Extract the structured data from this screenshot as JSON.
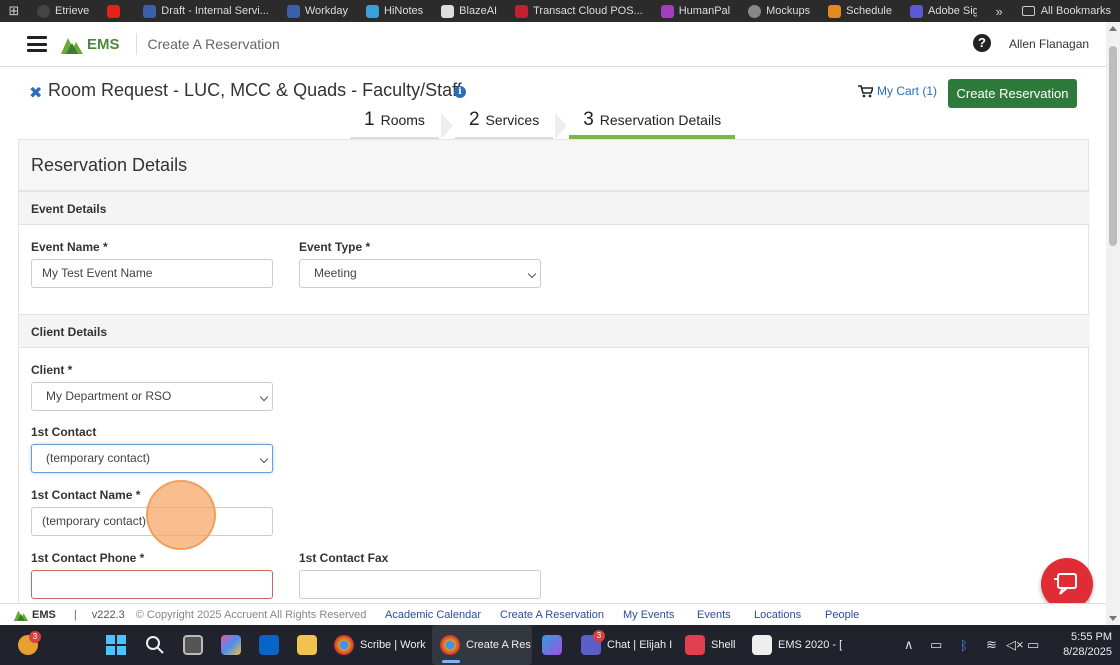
{
  "bookmarks": {
    "items": [
      "Etrieve",
      "Draft - Internal Servi...",
      "Workday",
      "HiNotes",
      "BlazeAI",
      "Transact Cloud POS...",
      "HumanPal",
      "Mockups",
      "Schedule",
      "Adobe Sign"
    ],
    "more": "»",
    "all_bookmarks": "All Bookmarks"
  },
  "header": {
    "brand": "EMS",
    "title": "Create A Reservation",
    "help": "?",
    "user": "Allen Flanagan"
  },
  "page": {
    "close": "✖",
    "title": "Room Request - LUC, MCC & Quads - Faculty/Staff",
    "info": "i",
    "cart_label": "My Cart (1)",
    "create_button": "Create Reservation"
  },
  "wizard": {
    "steps": [
      {
        "num": "1",
        "label": "Rooms"
      },
      {
        "num": "2",
        "label": "Services"
      },
      {
        "num": "3",
        "label": "Reservation Details"
      }
    ],
    "active_step": 3
  },
  "form": {
    "heading": "Reservation Details",
    "event_section": "Event Details",
    "event_name_label": "Event Name *",
    "event_name_value": "My Test Event Name",
    "event_type_label": "Event Type *",
    "event_type_value": "Meeting",
    "client_section": "Client Details",
    "client_label": "Client *",
    "client_value": "My Department or RSO",
    "contact_label": "1st Contact",
    "contact_value": "(temporary contact)",
    "contact_name_label": "1st Contact Name *",
    "contact_name_value": "(temporary contact)",
    "contact_phone_label": "1st Contact Phone *",
    "contact_phone_value": "",
    "contact_fax_label": "1st Contact Fax",
    "contact_fax_value": ""
  },
  "footer": {
    "brand": "EMS",
    "separator": "|",
    "version": "v222.3",
    "copyright": "© Copyright 2025 Accruent All Rights Reserved",
    "links": [
      "Academic Calendar",
      "Create A Reservation",
      "My Events",
      "Events",
      "Locations",
      "People"
    ]
  },
  "taskbar": {
    "apps": [
      {
        "label": "Scribe | Work",
        "icon": "chrome-icon"
      },
      {
        "label": "Create A Res",
        "icon": "chrome-icon"
      },
      {
        "label": "Chat | Elijah I",
        "icon": "teams-icon"
      },
      {
        "label": "Shell",
        "icon": "shell-icon"
      },
      {
        "label": "EMS 2020 - [",
        "icon": "ems-icon"
      }
    ],
    "badges": {
      "weather": "3",
      "teams": "3"
    },
    "time": "5:55 PM",
    "date": "8/28/2025"
  },
  "colors": {
    "primary_green": "#2d7a3a",
    "link_blue": "#2a6ebb",
    "active_step": "#7ab648",
    "chat_red": "#e02d35"
  }
}
